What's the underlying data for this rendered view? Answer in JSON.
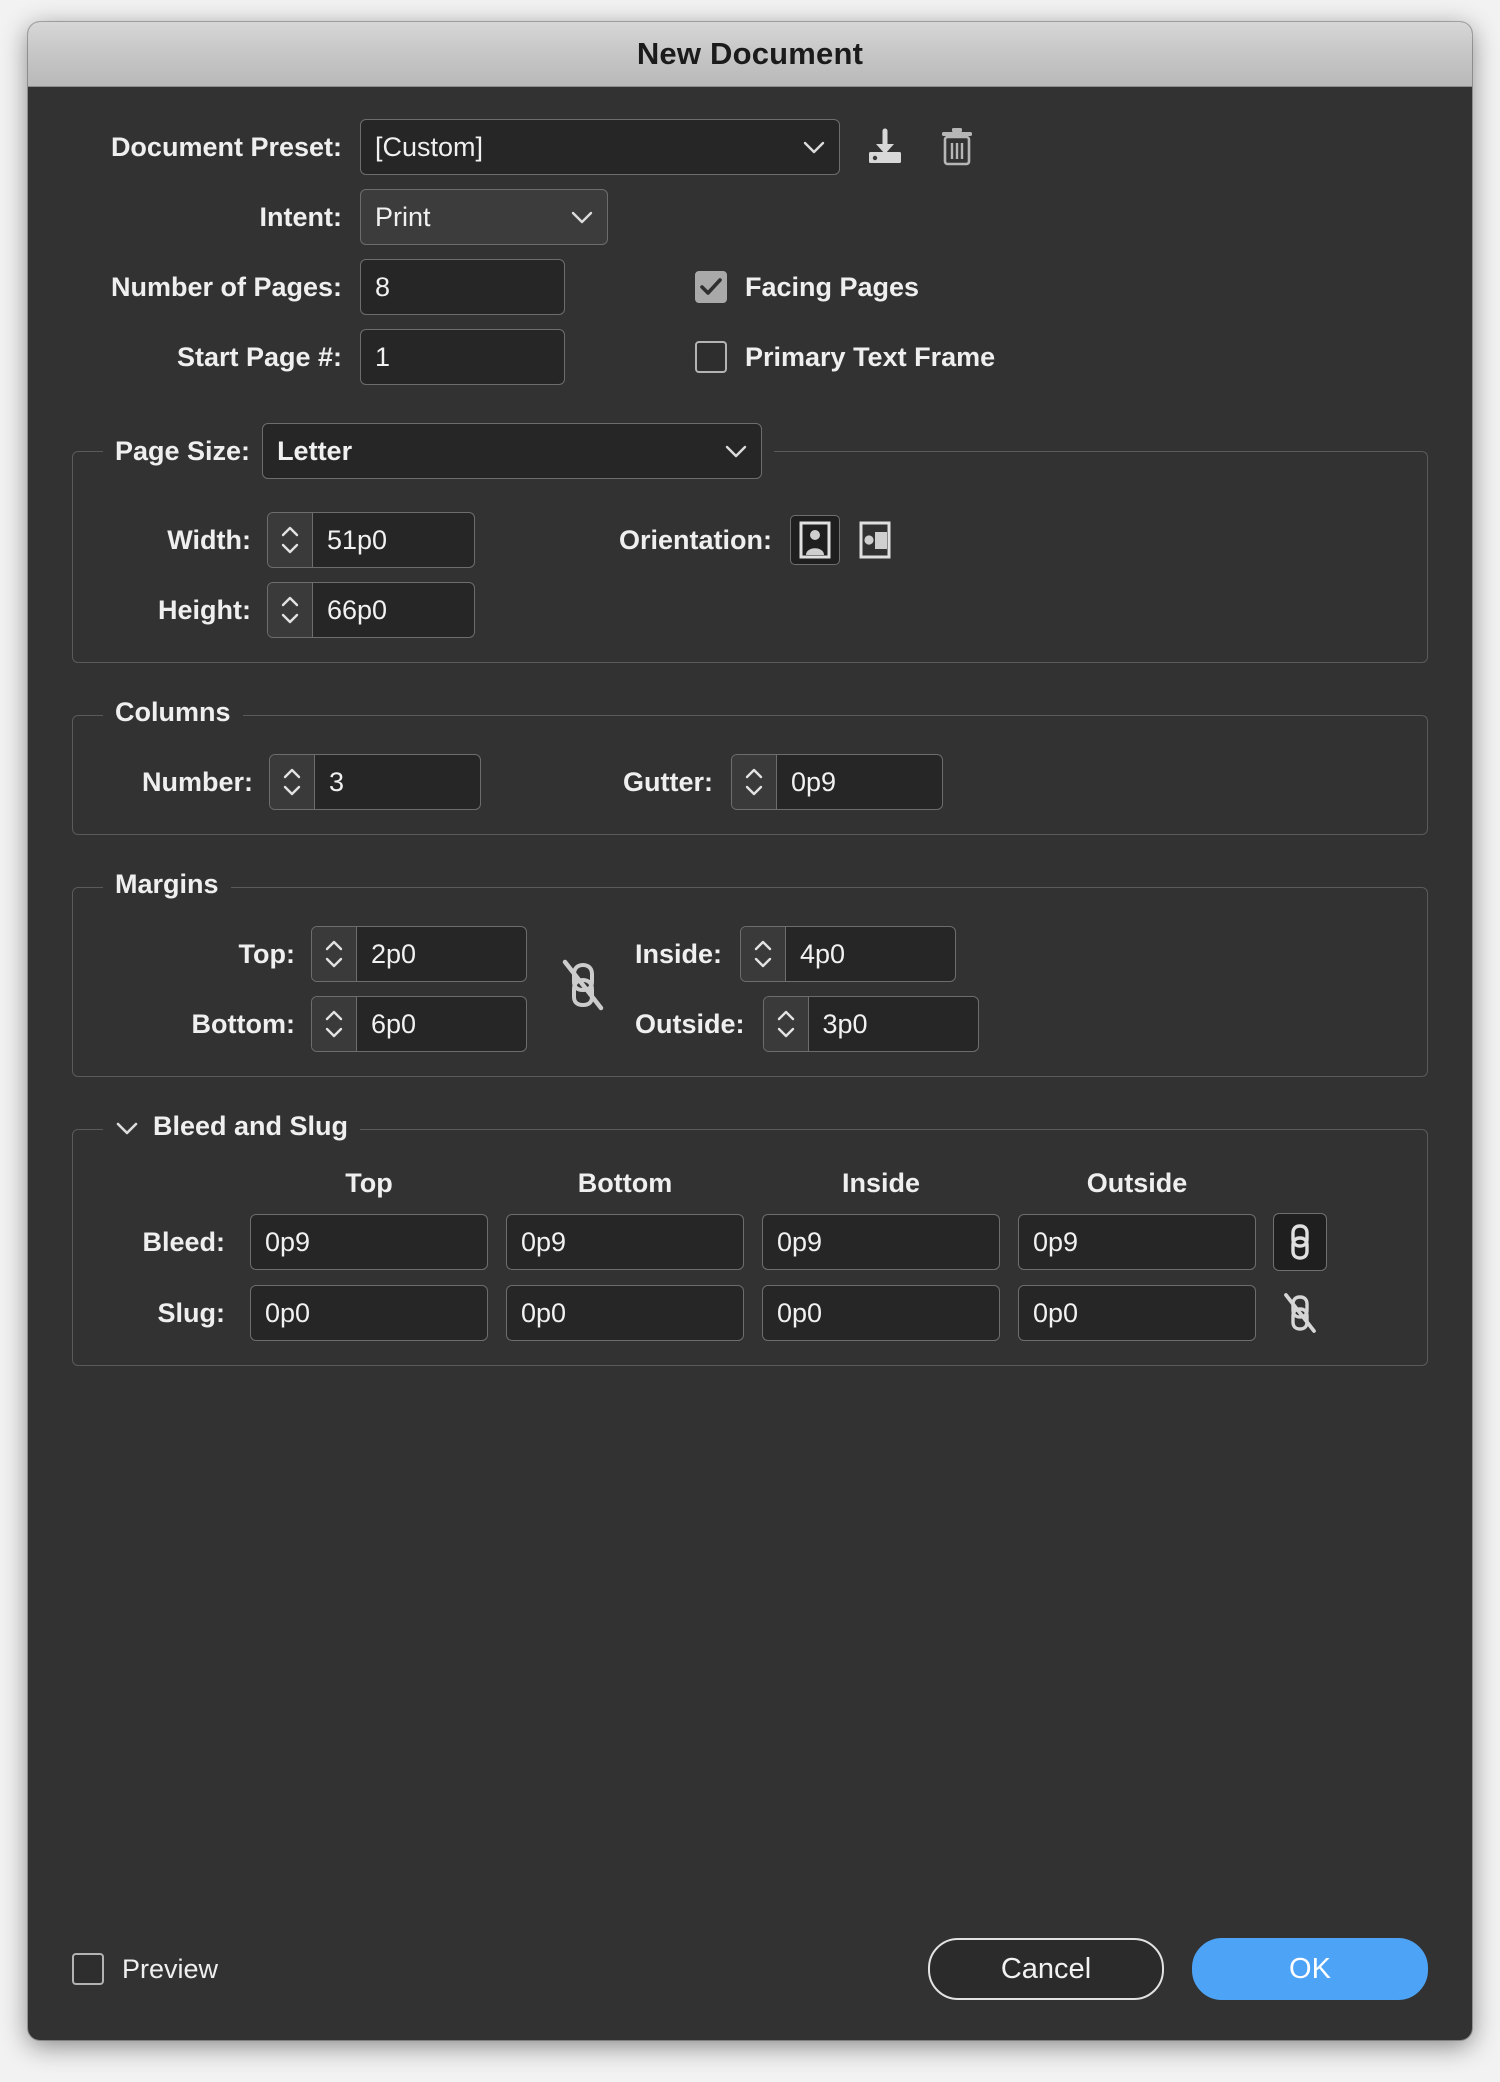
{
  "window": {
    "title": "New Document"
  },
  "preset": {
    "label": "Document Preset:",
    "value": "[Custom]",
    "save_icon": "save-preset-icon",
    "delete_icon": "trash-icon"
  },
  "intent": {
    "label": "Intent:",
    "value": "Print"
  },
  "pages": {
    "number_label": "Number of Pages:",
    "number_value": "8",
    "start_label": "Start Page #:",
    "start_value": "1"
  },
  "options": {
    "facing_pages_label": "Facing Pages",
    "facing_pages_checked": true,
    "primary_text_frame_label": "Primary Text Frame",
    "primary_text_frame_checked": false
  },
  "page_size": {
    "legend": "Page Size:",
    "value": "Letter",
    "width_label": "Width:",
    "width_value": "51p0",
    "height_label": "Height:",
    "height_value": "66p0",
    "orientation_label": "Orientation:",
    "orientation_selected": "portrait"
  },
  "columns": {
    "legend": "Columns",
    "number_label": "Number:",
    "number_value": "3",
    "gutter_label": "Gutter:",
    "gutter_value": "0p9"
  },
  "margins": {
    "legend": "Margins",
    "top_label": "Top:",
    "top_value": "2p0",
    "bottom_label": "Bottom:",
    "bottom_value": "6p0",
    "inside_label": "Inside:",
    "inside_value": "4p0",
    "outside_label": "Outside:",
    "outside_value": "3p0",
    "link_state": "unlinked"
  },
  "bleed_slug": {
    "legend": "Bleed and Slug",
    "expanded": true,
    "columns": [
      "Top",
      "Bottom",
      "Inside",
      "Outside"
    ],
    "bleed_label": "Bleed:",
    "bleed_values": [
      "0p9",
      "0p9",
      "0p9",
      "0p9"
    ],
    "bleed_link_state": "linked",
    "slug_label": "Slug:",
    "slug_values": [
      "0p0",
      "0p0",
      "0p0",
      "0p0"
    ],
    "slug_link_state": "unlinked"
  },
  "footer": {
    "preview_label": "Preview",
    "preview_checked": false,
    "cancel_label": "Cancel",
    "ok_label": "OK"
  },
  "colors": {
    "dialog_bg": "#323232",
    "titlebar_bg": "#c6c6c6",
    "field_bg": "#262626",
    "accent_blue": "#4da3f5",
    "text": "#efefef"
  }
}
